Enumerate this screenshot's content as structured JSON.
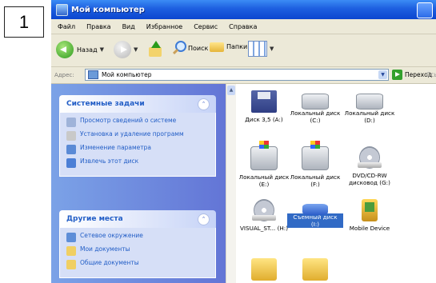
{
  "step_number": "1",
  "window": {
    "title": "Мой компьютер"
  },
  "menu": [
    "Файл",
    "Правка",
    "Вид",
    "Избранное",
    "Сервис",
    "Справка"
  ],
  "toolbar": {
    "back_label": "Назад",
    "search_label": "Поиск",
    "folders_label": "Папки"
  },
  "address": {
    "label": "Адрес:",
    "value": "Мой компьютер",
    "go_label": "Переход",
    "links_label": "Ссы"
  },
  "system_tasks": {
    "title": "Системные задачи",
    "items": [
      "Просмотр сведений о системе",
      "Установка и удаление программ",
      "Изменение параметра",
      "Извлечь этот диск"
    ]
  },
  "other_places": {
    "title": "Другие места",
    "items": [
      "Сетевое окружение",
      "Мои документы",
      "Общие документы"
    ]
  },
  "drives": [
    {
      "label": "Диск 3,5 (A:)",
      "icon": "floppy-drive-icon"
    },
    {
      "label": "Локальный диск (C:)",
      "icon": "hard-drive-icon"
    },
    {
      "label": "Локальный диск (D:)",
      "icon": "hard-drive-icon"
    },
    {
      "label": "Локальный диск (E:)",
      "icon": "hard-drive-windows-icon"
    },
    {
      "label": "Локальный диск (F:)",
      "icon": "hard-drive-windows-icon"
    },
    {
      "label": "DVD/CD-RW дисковод (G:)",
      "icon": "cd-drive-icon"
    },
    {
      "label": "VISUAL_ST... (H:)",
      "icon": "cd-disc-icon"
    },
    {
      "label": "Съемный диск (I:)",
      "icon": "removable-disk-icon",
      "selected": true
    },
    {
      "label": "Mobile Device",
      "icon": "mobile-device-icon"
    },
    {
      "label": "",
      "icon": "folder-icon"
    },
    {
      "label": "",
      "icon": "folder-icon"
    }
  ]
}
